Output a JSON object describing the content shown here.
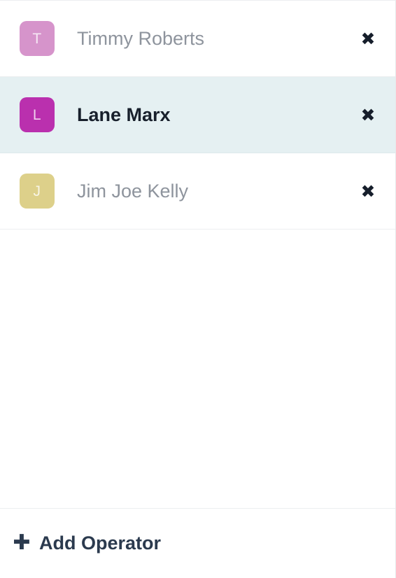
{
  "panel": {
    "background": "#ffffff",
    "border_color": "#eceef0"
  },
  "operator_list": {
    "selected_row_background": "#e5f0f2",
    "name_color_default": "#8e949d",
    "name_color_selected": "#18202c",
    "remove_icon": "close-x-icon",
    "remove_icon_glyph": "✖",
    "items": [
      {
        "name": "Timmy Roberts",
        "initial": "T",
        "avatar_color": "#d694cb",
        "selected": false
      },
      {
        "name": "Lane Marx",
        "initial": "L",
        "avatar_color": "#ba30ae",
        "selected": true
      },
      {
        "name": "Jim Joe Kelly",
        "initial": "J",
        "avatar_color": "#ddd08a",
        "selected": false
      }
    ]
  },
  "footer": {
    "add_operator_label": "Add Operator",
    "add_icon": "plus-icon",
    "add_icon_glyph": "✚",
    "accent_color": "#2b3a4e"
  }
}
